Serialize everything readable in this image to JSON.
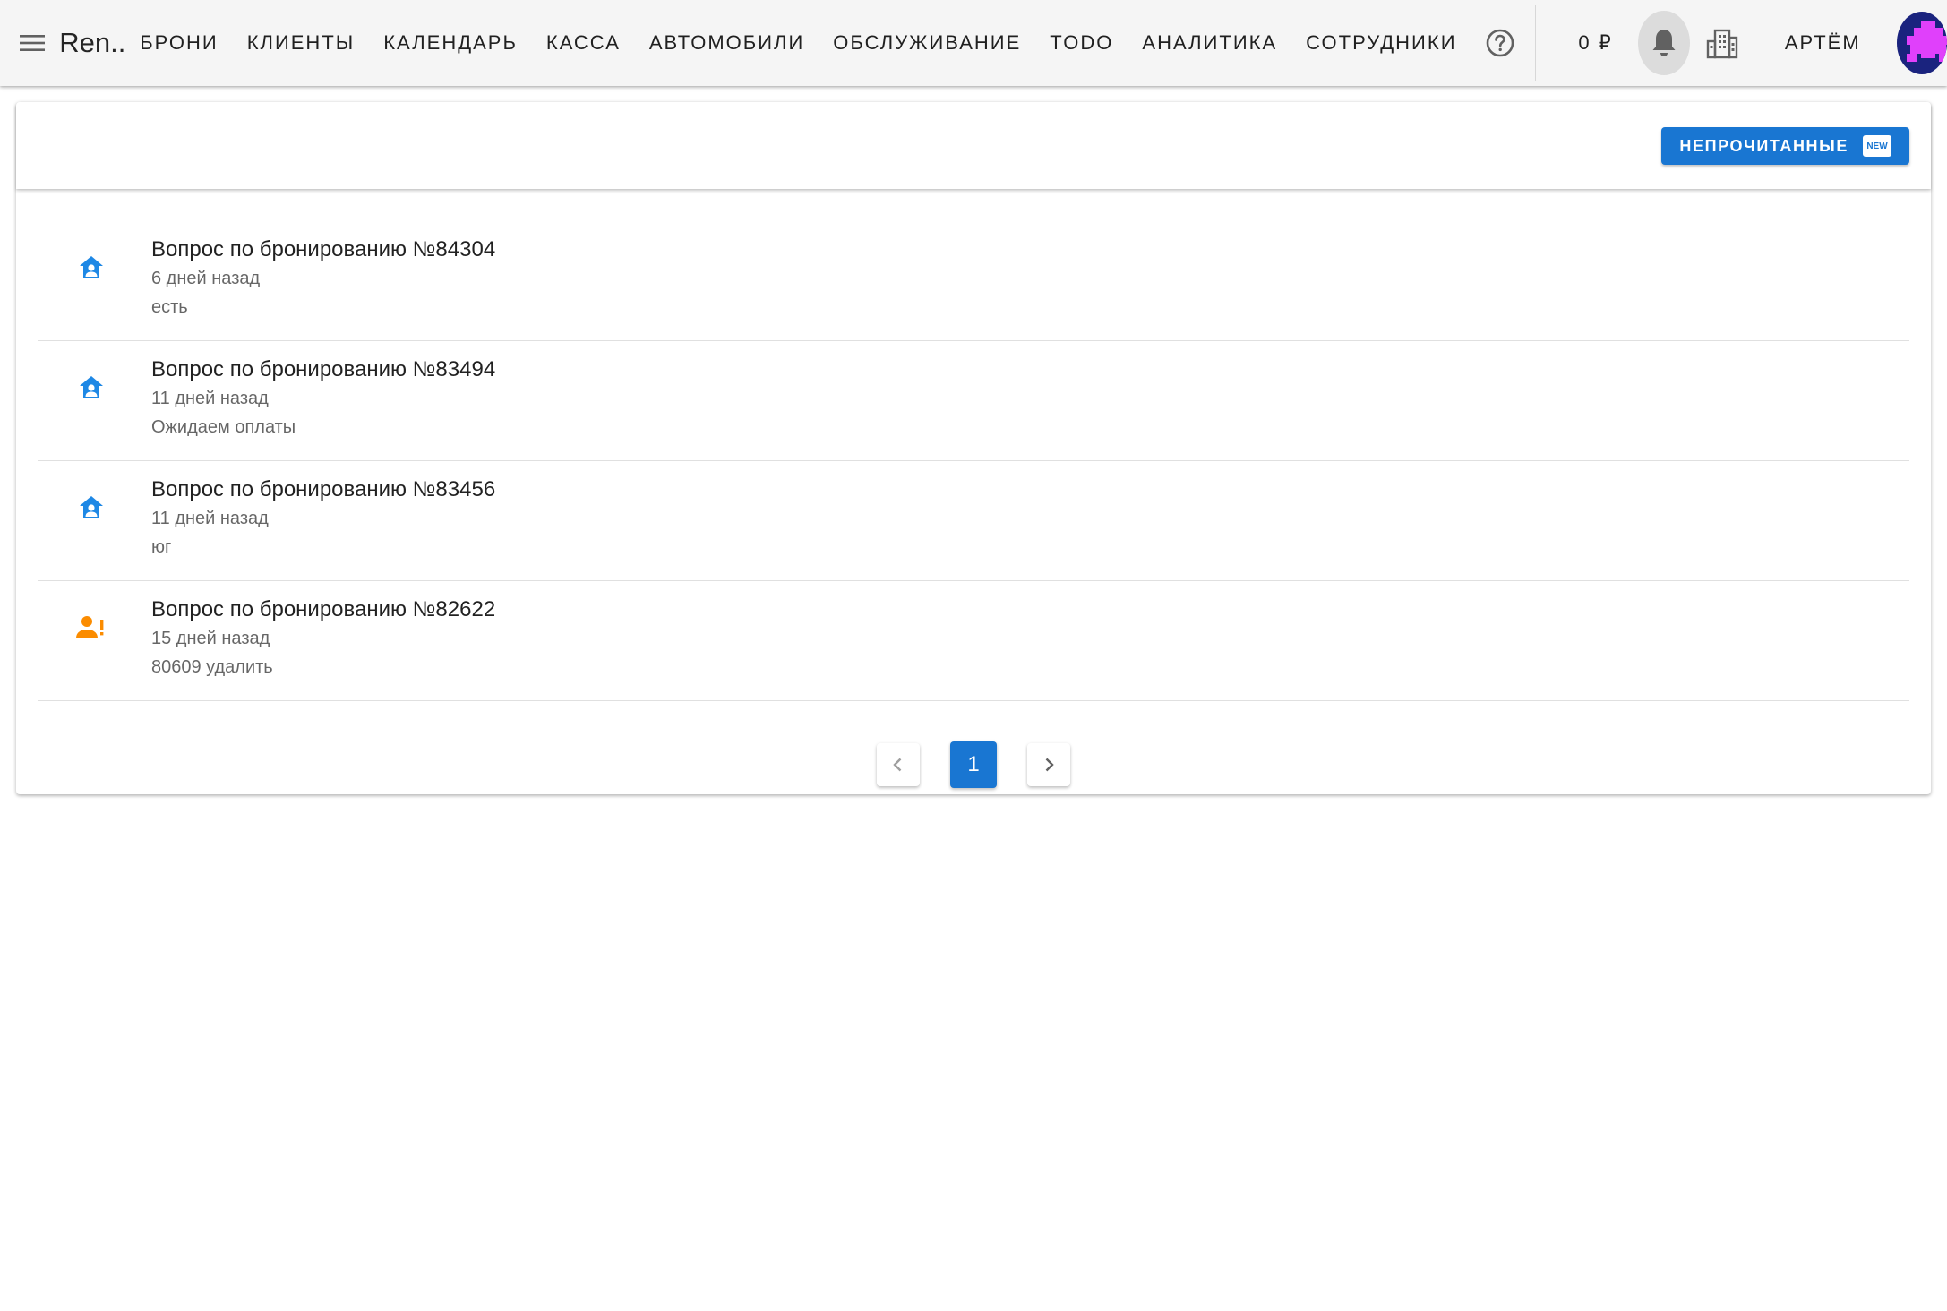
{
  "appbar": {
    "title": "Ren...",
    "nav": [
      {
        "label": "БРОНИ"
      },
      {
        "label": "КЛИЕНТЫ"
      },
      {
        "label": "КАЛЕНДАРЬ"
      },
      {
        "label": "КАССА"
      },
      {
        "label": "АВТОМОБИЛИ"
      },
      {
        "label": "ОБСЛУЖИВАНИЕ"
      },
      {
        "label": "TODO"
      },
      {
        "label": "АНАЛИТИКА"
      },
      {
        "label": "СОТРУДНИКИ"
      }
    ],
    "balance": "0 ₽",
    "user_name": "АРТЁМ",
    "icons": {
      "menu": "menu-icon",
      "help": "help-circle-icon",
      "bell": "bell-icon",
      "building": "building-icon"
    }
  },
  "toolbar": {
    "unread_label": "НЕПРОЧИТАННЫЕ",
    "new_badge": "NEW"
  },
  "notifications": [
    {
      "icon": "home-account-icon",
      "icon_color": "#1e88e5",
      "title": "Вопрос по бронированию №84304",
      "time": "6 дней назад",
      "message": "есть"
    },
    {
      "icon": "home-account-icon",
      "icon_color": "#1e88e5",
      "title": "Вопрос по бронированию №83494",
      "time": "11 дней назад",
      "message": "Ожидаем оплаты"
    },
    {
      "icon": "home-account-icon",
      "icon_color": "#1e88e5",
      "title": "Вопрос по бронированию №83456",
      "time": "11 дней назад",
      "message": "юг"
    },
    {
      "icon": "account-alert-icon",
      "icon_color": "#fb8c00",
      "title": "Вопрос по бронированию №82622",
      "time": "15 дней назад",
      "message": "80609 удалить"
    }
  ],
  "pagination": {
    "current_page": "1"
  },
  "colors": {
    "primary": "#1976d2",
    "appbar_bg": "#f5f5f5",
    "info_icon": "#1e88e5",
    "warning_icon": "#fb8c00",
    "avatar_bg": "#1a237e",
    "avatar_fg": "#e040fb"
  }
}
